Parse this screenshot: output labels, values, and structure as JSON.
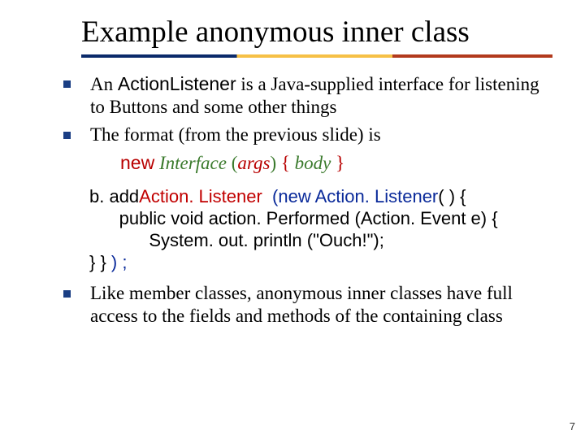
{
  "title": "Example anonymous inner class",
  "bullets": {
    "b1_pre": "An ",
    "b1_code": "ActionListener",
    "b1_post": " is a Java-supplied interface for listening to Buttons and some other things",
    "b2": "The format (from the previous slide) is",
    "b3": "Like member classes, anonymous inner classes have full access to the fields and methods of the containing class"
  },
  "syntax": {
    "new": "new",
    "iface": "Interface",
    "lpar": "(",
    "args": "args",
    "rpar": ")",
    "lbrace": "{",
    "body": "body",
    "rbrace": "}"
  },
  "code": {
    "l1a": "b. add",
    "l1b": "Action. Listener ",
    "l1c": " (new Action. Listener",
    "l1d": "( ) {",
    "l2": "      public void action. Performed (Action. Event e) {",
    "l3": "            System. out. println (\"Ouch!\");",
    "l4a": "} } ",
    "l4b": ") ;"
  },
  "page_number": "7"
}
